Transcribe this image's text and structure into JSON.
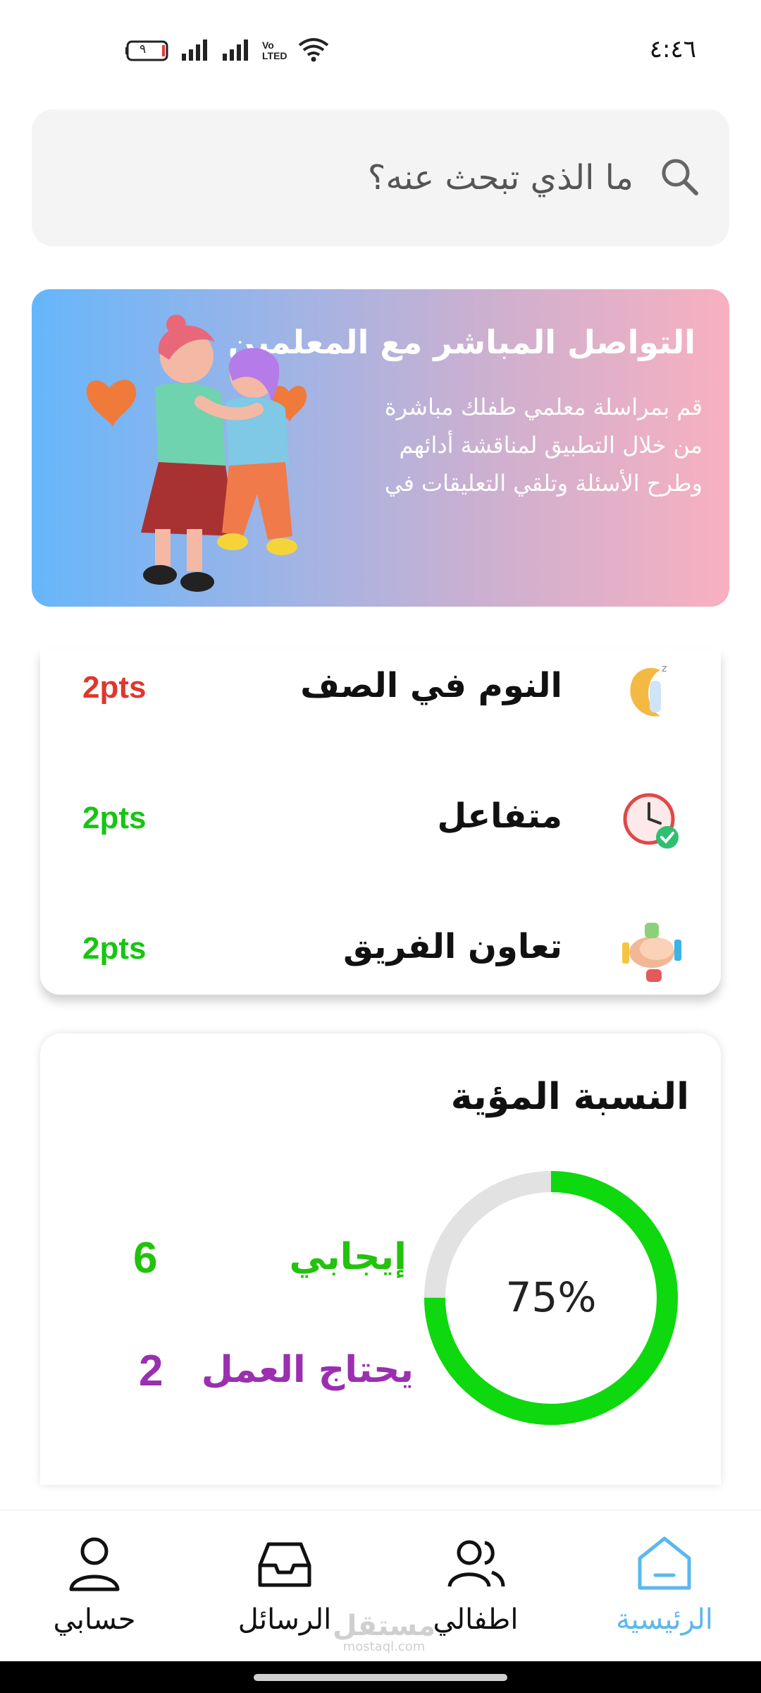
{
  "status_bar": {
    "time": "٤:٤٦",
    "battery_level": "٩",
    "volte_label_top": "Vo",
    "volte_label_bottom": "LTED"
  },
  "search": {
    "placeholder": "ما الذي تبحث عنه؟"
  },
  "banner": {
    "title": "التواصل المباشر مع المعلمين",
    "text": "قم بمراسلة معلمي طفلك مباشرة من خلال التطبيق لمناقشة أدائهم وطرح الأسئلة وتلقي التعليقات في"
  },
  "behaviors": [
    {
      "name": "النوم في الصف",
      "points": "2pts",
      "color": "#e0372d",
      "icon": "sleeping-moon-icon"
    },
    {
      "name": "متفاعل",
      "points": "2pts",
      "color": "#16c612",
      "icon": "clock-check-icon"
    },
    {
      "name": "تعاون الفريق",
      "points": "2pts",
      "color": "#16c612",
      "icon": "teamwork-hands-icon"
    }
  ],
  "percentage": {
    "title": "النسبة المؤية",
    "value_label": "75%",
    "value": 0.75,
    "positive_color": "#0ed80e",
    "remaining_color": "#e2e2e2",
    "legend": [
      {
        "label": "إيجابي",
        "value": "6",
        "color": "#22c20d"
      },
      {
        "label": "يحتاج العمل",
        "value": "2",
        "color": "#9a2fb0"
      }
    ]
  },
  "nav": {
    "items": [
      {
        "label": "الرئيسية",
        "icon": "home-icon",
        "active": true
      },
      {
        "label": "اطفالي",
        "icon": "children-icon",
        "active": false
      },
      {
        "label": "الرسائل",
        "icon": "inbox-icon",
        "active": false
      },
      {
        "label": "حسابي",
        "icon": "profile-icon",
        "active": false
      }
    ],
    "active_color": "#5bb8ee",
    "inactive_color": "#111111"
  },
  "watermark": {
    "arabic": "مستقل",
    "latin": "mostaql.com"
  }
}
